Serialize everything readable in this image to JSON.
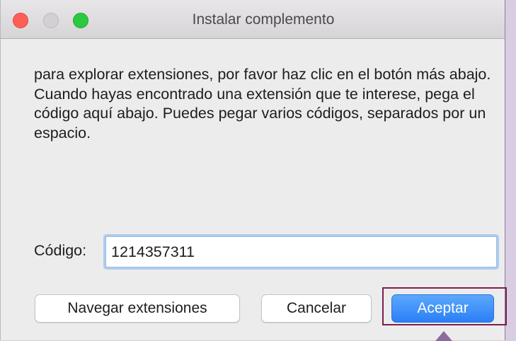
{
  "window": {
    "title": "Instalar complemento"
  },
  "message": {
    "paragraphs": [
      "para explorar extensiones, por favor haz clic en el botón más abajo.",
      "Cuando hayas encontrado una extensión que te interese, pega el código aquí abajo. Puedes pegar varios códigos, separados por un espacio."
    ]
  },
  "code_field": {
    "label": "Código:",
    "value": "1214357311"
  },
  "buttons": {
    "browse": "Navegar extensiones",
    "cancel": "Cancelar",
    "accept": "Aceptar"
  },
  "colors": {
    "accent": "#2a7ff7",
    "highlight": "#7b1f4f",
    "close": "#fd5f57",
    "zoom": "#2ac940"
  },
  "icons": {
    "close": "close-icon",
    "minimize": "minimize-icon",
    "zoom": "zoom-icon",
    "pointer": "arrow-pointer-icon"
  }
}
